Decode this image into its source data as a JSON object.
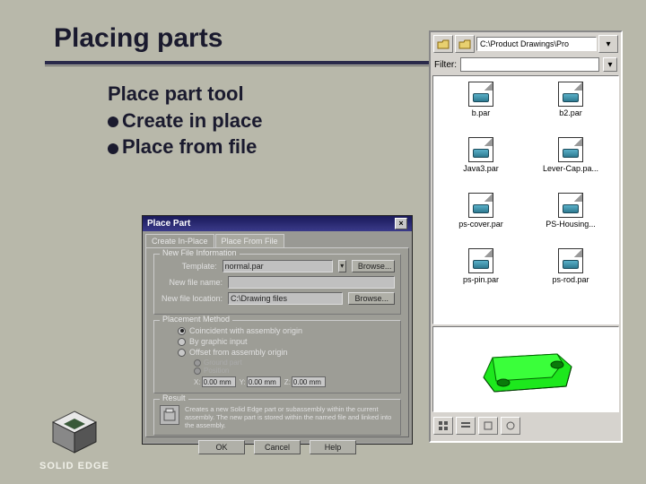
{
  "slide": {
    "title": "Placing parts",
    "heading": "Place part tool",
    "bullets": [
      "Create in place",
      "Place from file"
    ]
  },
  "logo": {
    "text": "SOLID EDGE"
  },
  "fileBrowser": {
    "path": "C:\\Product Drawings\\Pro",
    "filterLabel": "Filter:",
    "filterValue": "",
    "files": [
      {
        "name": "b.par"
      },
      {
        "name": "b2.par"
      },
      {
        "name": "Java3.par"
      },
      {
        "name": "Lever-Cap.pa..."
      },
      {
        "name": "ps-cover.par"
      },
      {
        "name": "PS-Housing..."
      },
      {
        "name": "ps-pin.par"
      },
      {
        "name": "ps-rod.par"
      }
    ]
  },
  "dialog": {
    "title": "Place Part",
    "tabs": [
      "Create In-Place",
      "Place From File"
    ],
    "newFileInfo": {
      "groupTitle": "New File Information",
      "templateLabel": "Template:",
      "templateValue": "normal.par",
      "browseTemplate": "Browse...",
      "nameLabel": "New file name:",
      "nameValue": "",
      "locationLabel": "New file location:",
      "locationValue": "C:\\Drawing files",
      "browseLocation": "Browse..."
    },
    "placement": {
      "groupTitle": "Placement Method",
      "opt1": "Coincident with assembly origin",
      "opt2": "By graphic input",
      "opt3": "Offset from assembly origin",
      "sub1": "Ground part",
      "sub2": "Position",
      "x": "0.00 mm",
      "y": "0.00 mm",
      "z": "0.00 mm",
      "xl": "X:",
      "yl": "Y:",
      "zl": "Z:"
    },
    "result": {
      "groupTitle": "Result",
      "text": "Creates a new Solid Edge part or subassembly within the current assembly. The new part is stored within the named file and linked into the assembly."
    },
    "buttons": {
      "ok": "OK",
      "cancel": "Cancel",
      "help": "Help"
    }
  }
}
